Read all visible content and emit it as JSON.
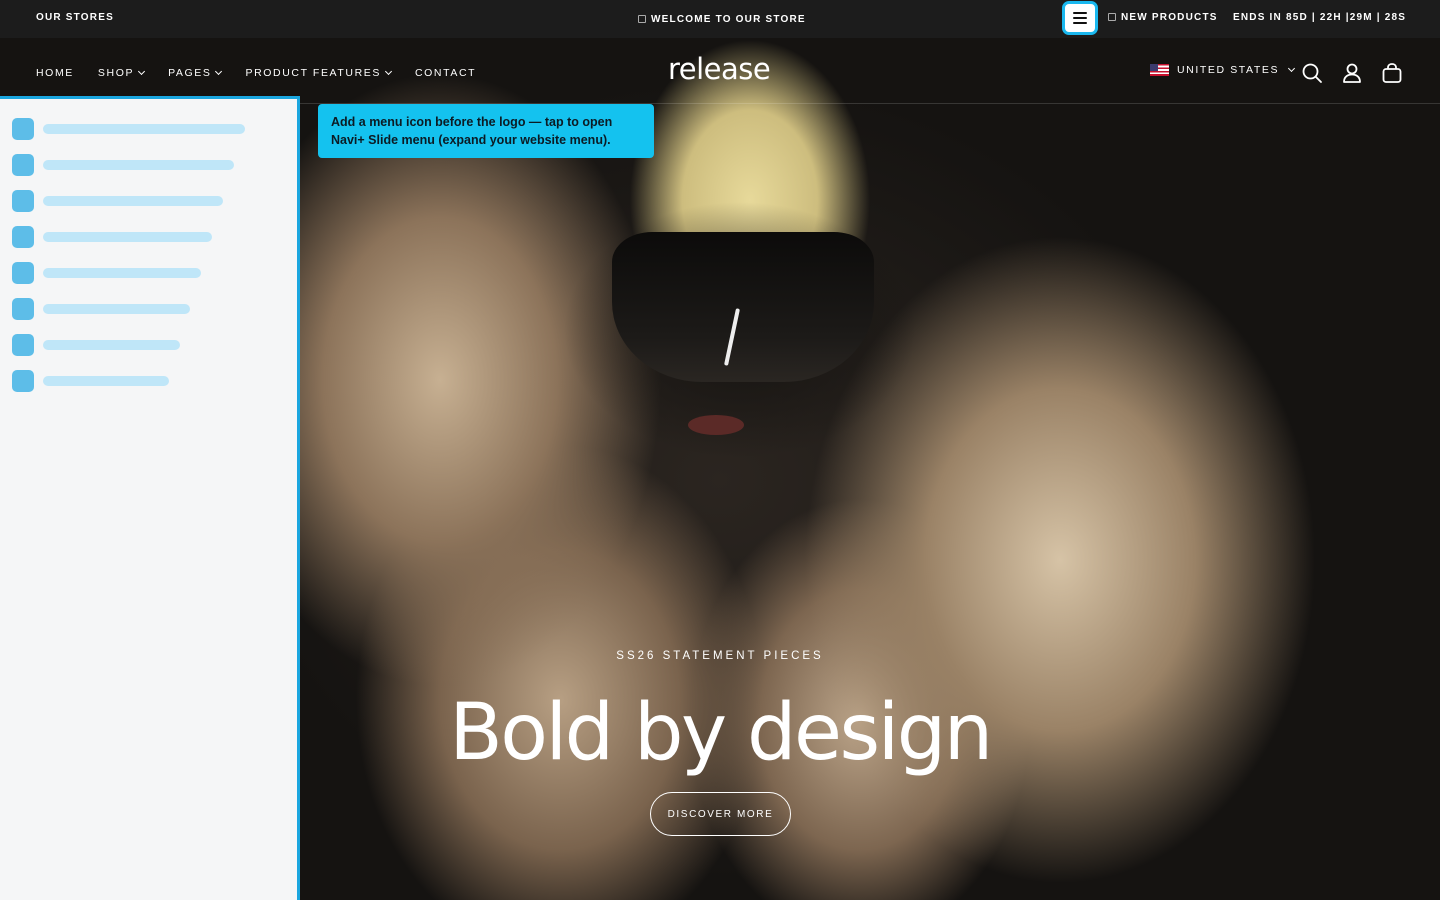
{
  "announcement": {
    "our_stores": "OUR STORES",
    "welcome": "WELCOME TO OUR STORE",
    "new_products": "NEW PRODUCTS",
    "countdown": "ENDS IN 85D | 22H |29M | 28S"
  },
  "header": {
    "logo": "release",
    "nav": [
      {
        "label": "HOME"
      },
      {
        "label": "SHOP"
      },
      {
        "label": "PAGES"
      },
      {
        "label": "PRODUCT FEATURES"
      },
      {
        "label": "CONTACT"
      }
    ],
    "region": "UNITED STATES"
  },
  "tooltip": {
    "text": "Add a menu icon before the logo — tap to open Navi+ Slide menu (expand your website menu)."
  },
  "hero": {
    "eyebrow": "SS26 STATEMENT PIECES",
    "headline": "Bold by design",
    "cta": "DISCOVER MORE"
  },
  "colors": {
    "accent": "#1ab8ef",
    "panel_bg": "#f5f6f7",
    "topbar_bg": "#1c1c1c"
  }
}
